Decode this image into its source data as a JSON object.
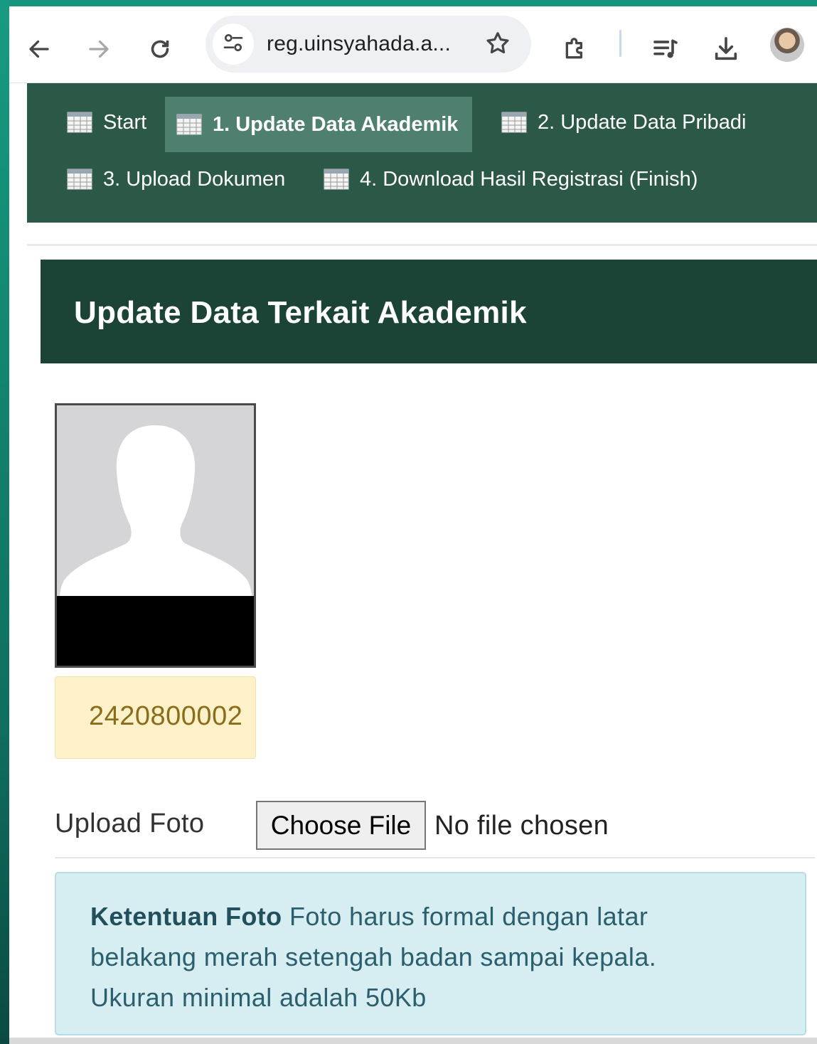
{
  "browser": {
    "url": "reg.uinsyahada.a...",
    "icons": {
      "back": "arrow-left-icon",
      "forward": "arrow-right-icon",
      "reload": "reload-icon",
      "site_info": "tune-icon",
      "bookmark": "star-icon",
      "extensions": "puzzle-icon",
      "media": "playlist-icon",
      "downloads": "download-icon",
      "profile": "avatar"
    }
  },
  "nav": {
    "items": [
      {
        "label": "Start"
      },
      {
        "label": "1. Update Data Akademik"
      },
      {
        "label": "2. Update Data Pribadi"
      },
      {
        "label": "3. Upload Dokumen"
      },
      {
        "label": "4. Download Hasil Registrasi (Finish)"
      }
    ],
    "active_index": 1
  },
  "panel": {
    "title": "Update Data Terkait Akademik"
  },
  "profile": {
    "nim": "2420800002"
  },
  "upload": {
    "label": "Upload Foto",
    "button_label": "Choose File",
    "status": "No file chosen"
  },
  "notice": {
    "title": "Ketentuan Foto",
    "line1": "Foto harus formal dengan latar",
    "line2": "belakang merah setengah badan sampai kepala.",
    "line3": "Ukuran minimal adalah 50Kb"
  },
  "colors": {
    "nav_bg": "#2c5848",
    "nav_active": "#4f7f6f",
    "panel_head": "#1b4336",
    "badge_bg": "#fcf1c8",
    "info_bg": "#d6edf2"
  }
}
